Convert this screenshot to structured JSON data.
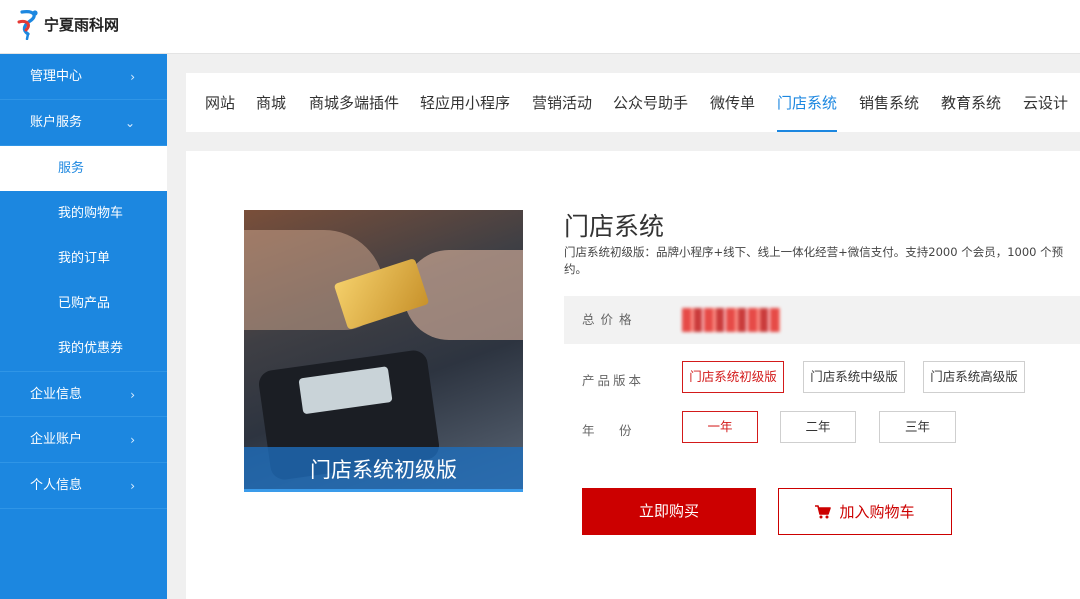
{
  "brand": {
    "name": "宁夏雨科网"
  },
  "sidebar": {
    "items": [
      {
        "label": "管理中心",
        "chevron": "›"
      },
      {
        "label": "账户服务",
        "chevron": "⌄"
      }
    ],
    "sub_items": [
      {
        "label": "服务"
      },
      {
        "label": "我的购物车"
      },
      {
        "label": "我的订单"
      },
      {
        "label": "已购产品"
      },
      {
        "label": "我的优惠券"
      }
    ],
    "bottom_items": [
      {
        "label": "企业信息",
        "chevron": "›"
      },
      {
        "label": "企业账户",
        "chevron": "›"
      },
      {
        "label": "个人信息",
        "chevron": "›"
      }
    ]
  },
  "nav": {
    "tabs": [
      "网站",
      "商城",
      "商城多端插件",
      "轻应用小程序",
      "营销活动",
      "公众号助手",
      "微传单",
      "门店系统",
      "销售系统",
      "教育系统",
      "云设计"
    ],
    "active": "门店系统"
  },
  "product": {
    "image_caption": "门店系统初级版",
    "title": "门店系统",
    "description": "门店系统初级版：品牌小程序+线下、线上一体化经营+微信支付。支持2000 个会员，1000 个预约。",
    "price_label": "总价格",
    "version_label": "产品版本",
    "year_label": "年　份",
    "versions": [
      "门店系统初级版",
      "门店系统中级版",
      "门店系统高级版"
    ],
    "selected_version": "门店系统初级版",
    "years": [
      "一年",
      "二年",
      "三年"
    ],
    "selected_year": "一年",
    "buy_label": "立即购买",
    "cart_label": "加入购物车"
  },
  "colors": {
    "accent": "#1c87e0",
    "danger": "#cc0000"
  }
}
